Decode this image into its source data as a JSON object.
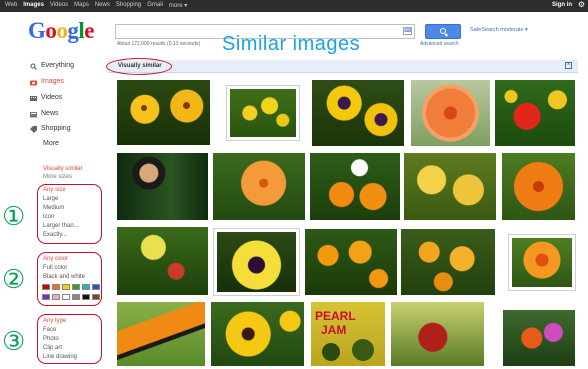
{
  "topbar": {
    "nav": [
      "Web",
      "Images",
      "Videos",
      "Maps",
      "News",
      "Shopping",
      "Gmail",
      "more ▾"
    ],
    "active": "Images",
    "signin": "Sign in",
    "gear_glyph": "⚙"
  },
  "header": {
    "logo": [
      "G",
      "o",
      "o",
      "g",
      "l",
      "e"
    ],
    "logo_colors": [
      "#3369e8",
      "#d50f25",
      "#eeb211",
      "#3369e8",
      "#009925",
      "#d50f25"
    ],
    "safesearch": "SafeSearch moderate ▾",
    "result_stats": "About 172,000 results (0.13 seconds)",
    "advanced_search": "Advanced search",
    "kbd_glyph": "⌨"
  },
  "overlay": {
    "title": "Similar images",
    "circled_numbers": [
      "①",
      "②",
      "③"
    ]
  },
  "sidebar": {
    "items": [
      {
        "label": "Everything",
        "icon": "search-icon"
      },
      {
        "label": "Images",
        "icon": "camera-icon",
        "active": true
      },
      {
        "label": "Videos",
        "icon": "film-icon"
      },
      {
        "label": "News",
        "icon": "newspaper-icon"
      },
      {
        "label": "Shopping",
        "icon": "tag-icon"
      },
      {
        "label": "More",
        "icon": ""
      }
    ],
    "similarity": [
      "Visually similar",
      "More sizes"
    ],
    "size": [
      "Any size",
      "Large",
      "Medium",
      "Icon",
      "Larger than...",
      "Exactly..."
    ],
    "color": [
      "Any color",
      "Full color",
      "Black and white"
    ],
    "swatches_row1": [
      "#cc0000",
      "#e8731a",
      "#f4d000",
      "#33a02c",
      "#1cb4c6",
      "#2255cc"
    ],
    "swatches_row2": [
      "#7b2fbe",
      "#f5a8c8",
      "#ffffff",
      "#8a8a8a",
      "#111111",
      "#7a4a1e"
    ],
    "type": [
      "Any type",
      "Face",
      "Photo",
      "Clip art",
      "Line drawing"
    ]
  },
  "results": {
    "label": "Visually similar",
    "close_glyph": "×"
  },
  "colors": {
    "active_red": "#dd4b39",
    "link_blue": "#4a6ab5",
    "annotation_red": "#c8102e",
    "annotation_green": "#0aa05a",
    "overlay_blue": "#1aa3e8"
  }
}
